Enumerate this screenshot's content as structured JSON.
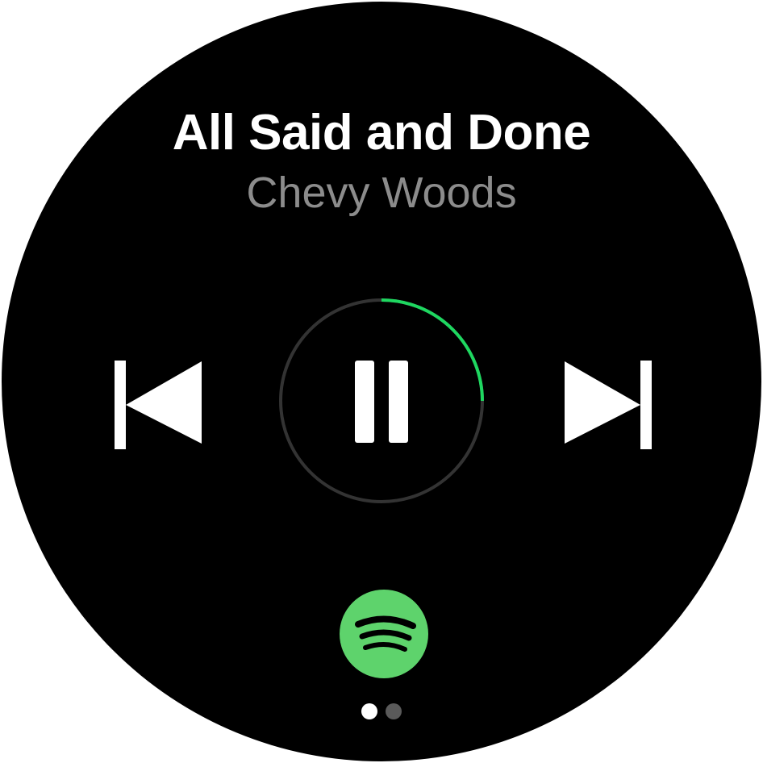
{
  "track": {
    "title": "All Said and Done",
    "artist": "Chevy Woods"
  },
  "playback": {
    "state": "playing",
    "progress_fraction": 0.25
  },
  "controls": {
    "previous_icon": "skip-previous-icon",
    "play_pause_icon": "pause-icon",
    "next_icon": "skip-next-icon"
  },
  "app": {
    "logo_icon": "spotify-logo-icon"
  },
  "pagination": {
    "total_pages": 2,
    "active_page": 1
  },
  "colors": {
    "background": "#000000",
    "title": "#ffffff",
    "artist": "#8c8c8c",
    "progress": "#1ed760",
    "progress_track": "#333333",
    "spotify_green": "#5ed36c"
  }
}
